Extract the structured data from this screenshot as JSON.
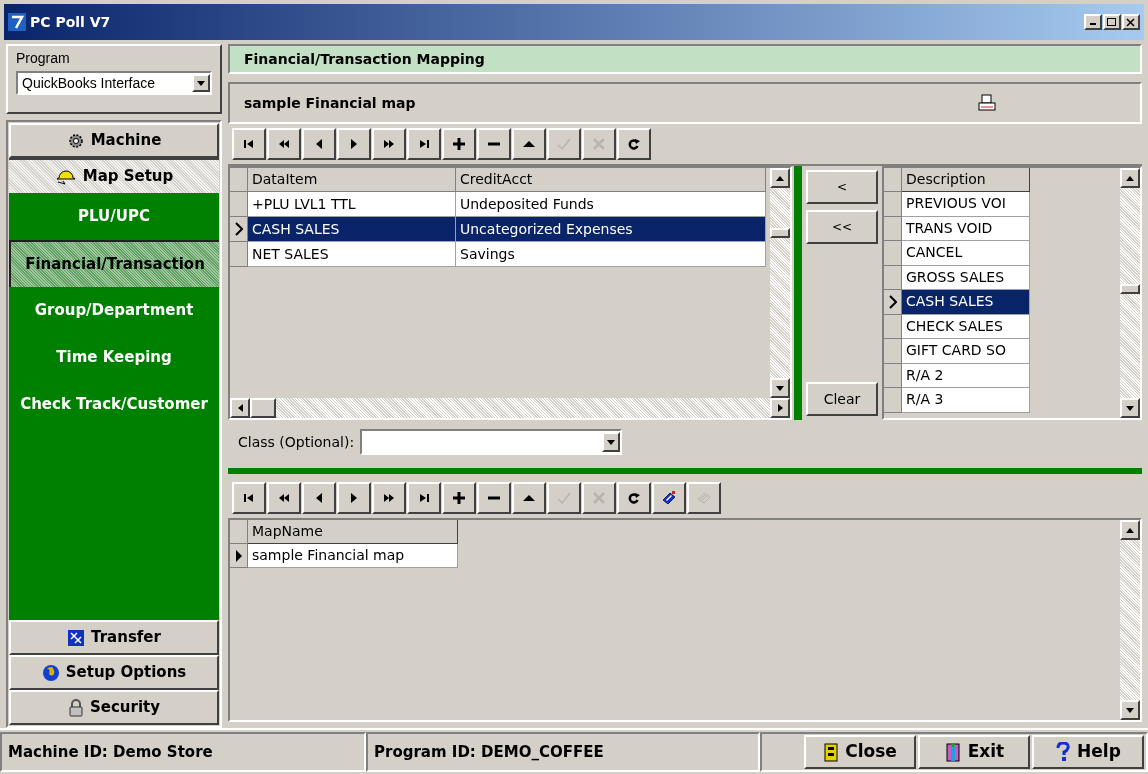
{
  "window": {
    "title": "PC Poll V7"
  },
  "program": {
    "label": "Program",
    "value": "QuickBooks Interface"
  },
  "sidebar": {
    "top": [
      {
        "label": "Machine",
        "selected": false
      },
      {
        "label": "Map Setup",
        "selected": true
      }
    ],
    "subitems": [
      {
        "label": "PLU/UPC",
        "selected": false
      },
      {
        "label": "Financial/Transaction",
        "selected": true
      },
      {
        "label": "Group/Department",
        "selected": false
      },
      {
        "label": "Time Keeping",
        "selected": false
      },
      {
        "label": "Check Track/Customer",
        "selected": false
      }
    ],
    "bottom": [
      {
        "label": "Transfer",
        "selected": false
      },
      {
        "label": "Setup Options",
        "selected": false
      },
      {
        "label": "Security",
        "selected": false
      }
    ]
  },
  "header": {
    "title": "Financial/Transaction Mapping",
    "subtitle": "sample Financial map"
  },
  "toolbar": [
    {
      "kind": "first",
      "disabled": false
    },
    {
      "kind": "prior-page",
      "disabled": false
    },
    {
      "kind": "prior",
      "disabled": false
    },
    {
      "kind": "next",
      "disabled": false
    },
    {
      "kind": "next-page",
      "disabled": false
    },
    {
      "kind": "last",
      "disabled": false
    },
    {
      "kind": "insert",
      "disabled": false
    },
    {
      "kind": "delete",
      "disabled": false
    },
    {
      "kind": "edit",
      "disabled": false
    },
    {
      "kind": "post",
      "disabled": true
    },
    {
      "kind": "cancel",
      "disabled": true
    },
    {
      "kind": "refresh",
      "disabled": false
    }
  ],
  "mapping_grid": {
    "columns": [
      "DataItem",
      "CreditAcct"
    ],
    "rows": [
      {
        "cells": [
          "+PLU LVL1 TTL",
          "Undeposited Funds"
        ],
        "selected": false
      },
      {
        "cells": [
          "CASH SALES",
          "Uncategorized Expenses"
        ],
        "selected": true
      },
      {
        "cells": [
          "NET SALES",
          "Savings"
        ],
        "selected": false
      }
    ]
  },
  "move_buttons": [
    "<",
    "<<"
  ],
  "clear_button": "Clear",
  "description_grid": {
    "column": "Description",
    "rows": [
      {
        "text": "PREVIOUS VOI",
        "selected": false
      },
      {
        "text": "TRANS VOID",
        "selected": false
      },
      {
        "text": "CANCEL",
        "selected": false
      },
      {
        "text": "GROSS SALES",
        "selected": false
      },
      {
        "text": "CASH SALES",
        "selected": true
      },
      {
        "text": "CHECK SALES",
        "selected": false
      },
      {
        "text": "GIFT CARD SO",
        "selected": false
      },
      {
        "text": "R/A 2",
        "selected": false
      },
      {
        "text": "R/A 3",
        "selected": false
      }
    ]
  },
  "class_field": {
    "label": "Class (Optional):"
  },
  "toolbar2": [
    {
      "kind": "first",
      "disabled": false
    },
    {
      "kind": "prior-page",
      "disabled": false
    },
    {
      "kind": "prior",
      "disabled": false
    },
    {
      "kind": "next",
      "disabled": false
    },
    {
      "kind": "next-page",
      "disabled": false
    },
    {
      "kind": "last",
      "disabled": false
    },
    {
      "kind": "insert",
      "disabled": false
    },
    {
      "kind": "delete",
      "disabled": false
    },
    {
      "kind": "edit",
      "disabled": false
    },
    {
      "kind": "post",
      "disabled": true
    },
    {
      "kind": "cancel",
      "disabled": true
    },
    {
      "kind": "refresh",
      "disabled": false
    },
    {
      "kind": "bookmark",
      "disabled": false
    },
    {
      "kind": "goto",
      "disabled": true
    }
  ],
  "map_grid": {
    "column": "MapName",
    "rows": [
      {
        "text": "sample Financial map",
        "selected": true
      }
    ]
  },
  "status_bar": {
    "machine": "Machine ID: Demo Store",
    "program": "Program ID: DEMO_COFFEE"
  },
  "buttons": [
    "Close",
    "Exit",
    "Help"
  ]
}
